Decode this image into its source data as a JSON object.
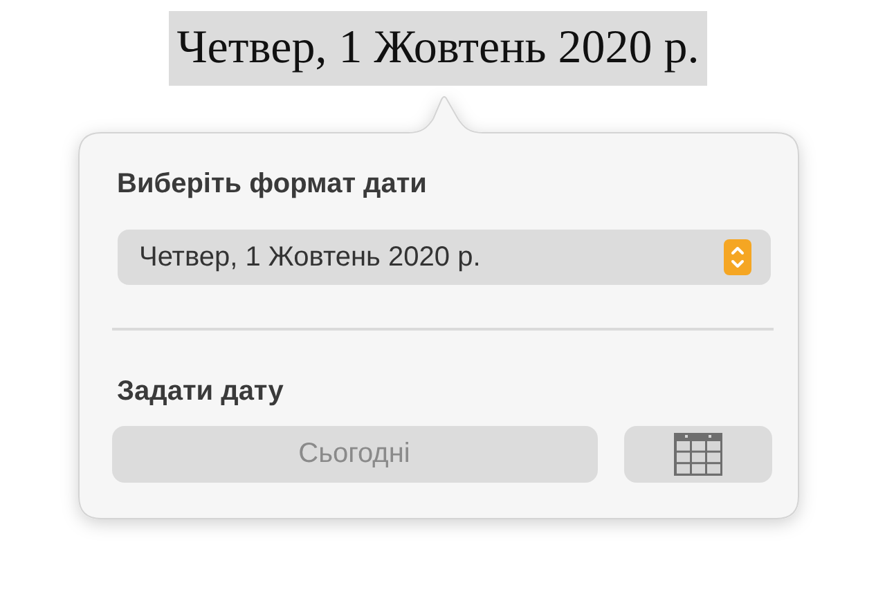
{
  "document_text": {
    "text": "Четвер, 1 Жовтень 2020 р.",
    "selected": true
  },
  "popover": {
    "format_heading": "Виберіть формат дати",
    "format_popup": {
      "value": "Четвер, 1 Жовтень 2020 р."
    },
    "set_date_heading": "Задати дату",
    "today_button": {
      "label": "Сьогодні",
      "disabled": true
    }
  }
}
